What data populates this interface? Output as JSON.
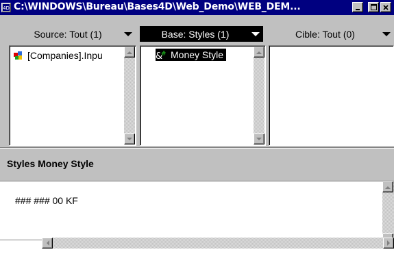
{
  "window": {
    "title": "C:\\WINDOWS\\Bureau\\Bases4D\\Web_Demo\\WEB_DEM...",
    "buttons": {
      "minimize": "_",
      "maximize": "□",
      "close": "×"
    }
  },
  "columns": [
    {
      "label": "Source: Tout (1)",
      "selected": false
    },
    {
      "label": "Base: Styles (1)",
      "selected": true
    },
    {
      "label": "Cible: Tout (0)",
      "selected": false
    }
  ],
  "lists": {
    "source": {
      "items": [
        {
          "label": "[Companies].Inpu",
          "icon": "form-icon"
        }
      ]
    },
    "base": {
      "items": [
        {
          "label": "Money Style",
          "icon": "style-icon",
          "selected": true
        }
      ]
    },
    "cible": {
      "items": []
    }
  },
  "section": {
    "title": "Styles Money Style"
  },
  "editor": {
    "content": "### ### 00 KF"
  },
  "colors": {
    "titlebar": "#000080",
    "selection": "#000000",
    "face": "#c0c0c0"
  }
}
